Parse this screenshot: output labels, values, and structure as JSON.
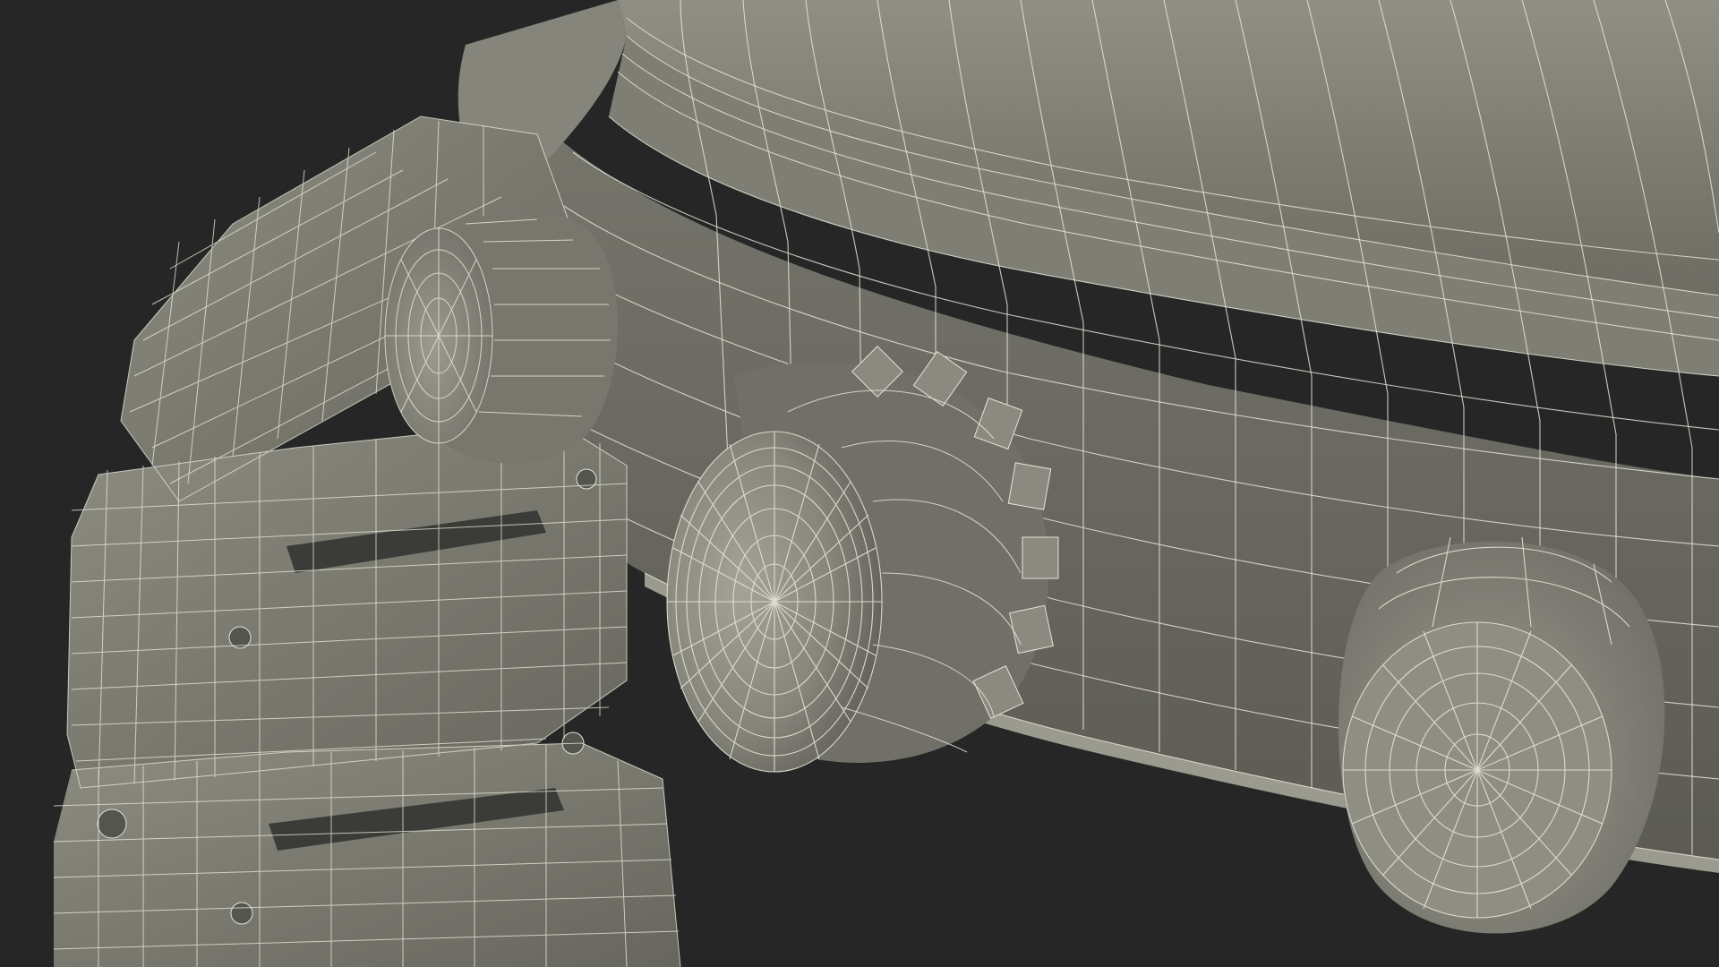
{
  "scene": {
    "subject": "wireframe-render",
    "colors": {
      "background": "#262626",
      "surface_light": "#8e8e83",
      "surface_mid": "#7b7b71",
      "surface_dark": "#5f5f57",
      "surface_shadow": "#4c4c46",
      "wire": "#e4e4d6"
    }
  }
}
